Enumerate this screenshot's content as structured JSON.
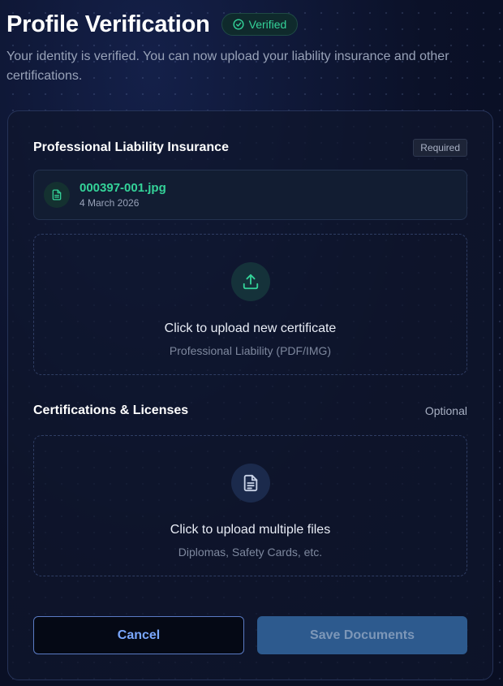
{
  "header": {
    "title": "Profile Verification",
    "badge": "Verified",
    "subtitle": "Your identity is verified. You can now upload your liability insurance and other certifications."
  },
  "insurance": {
    "title": "Professional Liability Insurance",
    "tag": "Required",
    "file": {
      "name": "000397-001.jpg",
      "date": "4 March 2026",
      "icon": "document-icon"
    },
    "upload": {
      "icon": "upload-icon",
      "title": "Click to upload new certificate",
      "subtitle": "Professional Liability (PDF/IMG)"
    }
  },
  "certifications": {
    "title": "Certifications & Licenses",
    "tag": "Optional",
    "upload": {
      "icon": "file-text-icon",
      "title": "Click to upload multiple files",
      "subtitle": "Diplomas, Safety Cards, etc."
    }
  },
  "actions": {
    "cancel_label": "Cancel",
    "save_label": "Save Documents"
  },
  "colors": {
    "accent_green": "#34d399",
    "accent_blue": "#7aa7ff",
    "save_button": "#2d5a8e"
  }
}
